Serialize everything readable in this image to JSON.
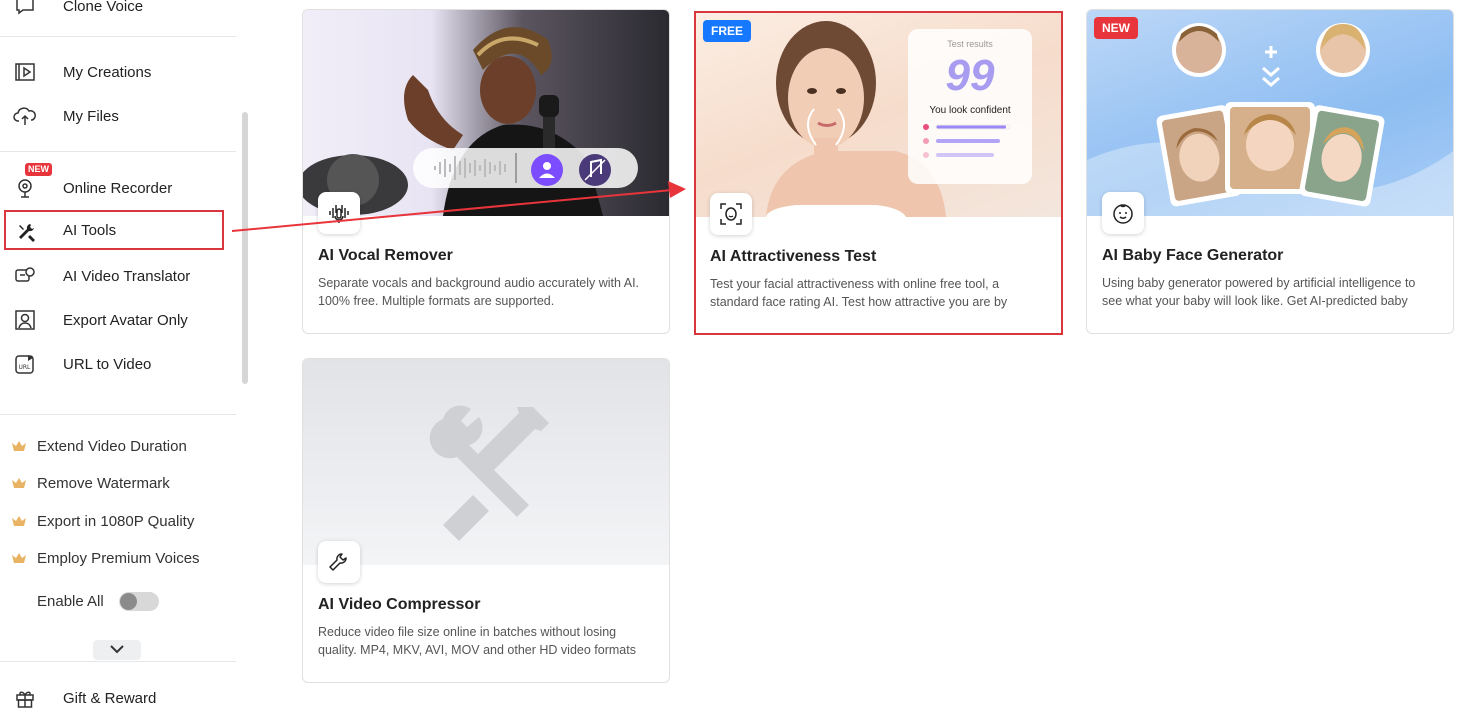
{
  "sidebar": {
    "clone_voice": "Clone Voice",
    "items": [
      {
        "label": "My Creations",
        "icon": "play-square-icon"
      },
      {
        "label": "My Files",
        "icon": "cloud-upload-icon"
      },
      {
        "label": "Online Recorder",
        "icon": "webcam-icon",
        "tag": "NEW"
      },
      {
        "label": "AI Tools",
        "icon": "tools-icon"
      },
      {
        "label": "AI Video Translator",
        "icon": "translate-icon"
      },
      {
        "label": "Export Avatar Only",
        "icon": "avatar-icon"
      },
      {
        "label": "URL to Video",
        "icon": "url-icon"
      }
    ],
    "premium": [
      {
        "label": "Extend Video Duration"
      },
      {
        "label": "Remove Watermark"
      },
      {
        "label": "Export in 1080P Quality"
      },
      {
        "label": "Employ Premium Voices"
      }
    ],
    "enable_all": "Enable All",
    "enable_all_on": false,
    "gift": "Gift & Reward"
  },
  "cards": [
    {
      "title": "AI Vocal Remover",
      "desc": "Separate vocals and background audio accurately with AI. 100% free. Multiple formats are supported."
    },
    {
      "title": "AI Attractiveness Test",
      "desc": "Test your facial attractiveness with online free tool, a standard face rating AI. Test how attractive you are by uploading a photo.",
      "badge": "FREE",
      "result_label": "Test results",
      "score": "99",
      "result_text": "You look confident"
    },
    {
      "title": "AI Baby Face Generator",
      "desc": "Using baby generator powered by artificial intelligence to see what your baby will look like. Get AI-predicted baby photos.",
      "badge": "NEW"
    },
    {
      "title": "AI Video Compressor",
      "desc": "Reduce video file size online in batches without losing quality. MP4, MKV, AVI, MOV and other HD video formats supported."
    }
  ],
  "colors": {
    "accent_red": "#d9363e",
    "free_badge": "#1677ff",
    "new_badge": "#e8343b",
    "crown": "#e8b363"
  }
}
